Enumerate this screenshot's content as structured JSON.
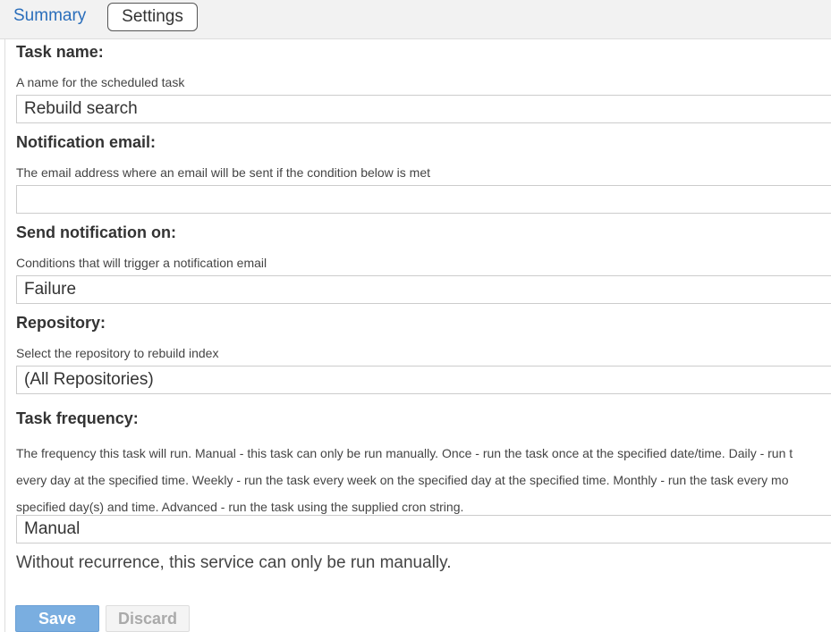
{
  "tabs": {
    "summary": "Summary",
    "settings": "Settings"
  },
  "fields": {
    "task_name": {
      "label": "Task name:",
      "help": "A name for the scheduled task",
      "value": "Rebuild search"
    },
    "notification_email": {
      "label": "Notification email:",
      "help": "The email address where an email will be sent if the condition below is met",
      "value": ""
    },
    "send_notification_on": {
      "label": "Send notification on:",
      "help": "Conditions that will trigger a notification email",
      "value": "Failure"
    },
    "repository": {
      "label": "Repository:",
      "help": "Select the repository to rebuild index",
      "value": "(All Repositories)"
    },
    "task_frequency": {
      "label": "Task frequency:",
      "help_lines": [
        "The frequency this task will run. Manual - this task can only be run manually. Once - run the task once at the specified date/time. Daily - run t",
        "every day at the specified time. Weekly - run the task every week on the specified day at the specified time. Monthly - run the task every mo",
        "specified day(s) and time. Advanced - run the task using the supplied cron string."
      ],
      "value": "Manual"
    }
  },
  "recurrence_note": "Without recurrence, this service can only be run manually.",
  "buttons": {
    "save": "Save",
    "discard": "Discard"
  },
  "colors": {
    "link": "#2a6ebb",
    "save_button": "#7aaee0",
    "discard_button": "#f4f4f4"
  }
}
